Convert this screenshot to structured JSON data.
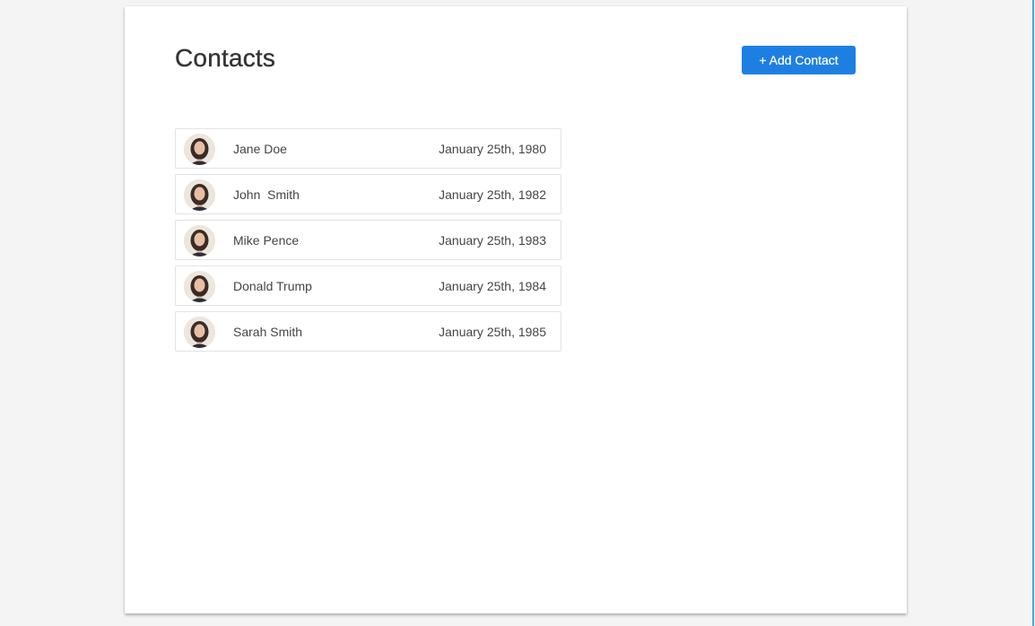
{
  "page": {
    "title": "Contacts"
  },
  "header": {
    "add_button_label": "+ Add Contact"
  },
  "colors": {
    "accent": "#1e7fe3",
    "page_background": "#f4f4f4",
    "card_background": "#ffffff",
    "edge_line": "#4aa3df"
  },
  "contacts": [
    {
      "name": "Jane Doe",
      "date": "January 25th, 1980",
      "avatar_icon": "person-avatar-icon"
    },
    {
      "name": "John  Smith",
      "date": "January 25th, 1982",
      "avatar_icon": "person-avatar-icon"
    },
    {
      "name": "Mike Pence",
      "date": "January 25th, 1983",
      "avatar_icon": "person-avatar-icon"
    },
    {
      "name": "Donald Trump",
      "date": "January 25th, 1984",
      "avatar_icon": "person-avatar-icon"
    },
    {
      "name": "Sarah Smith",
      "date": "January 25th, 1985",
      "avatar_icon": "person-avatar-icon"
    }
  ]
}
